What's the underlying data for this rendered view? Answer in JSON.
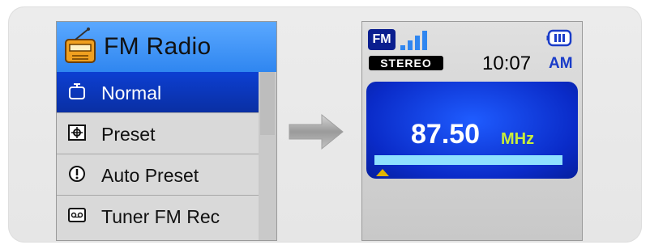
{
  "menu": {
    "title": "FM Radio",
    "items": [
      {
        "label": "Normal",
        "icon": "timer-icon",
        "selected": true
      },
      {
        "label": "Preset",
        "icon": "preset-icon",
        "selected": false
      },
      {
        "label": "Auto Preset",
        "icon": "auto-preset-icon",
        "selected": false
      },
      {
        "label": "Tuner FM Rec",
        "icon": "record-icon",
        "selected": false
      }
    ]
  },
  "screen": {
    "band": "FM",
    "stereo": "STEREO",
    "time": "10:07",
    "ampm": "AM",
    "frequency": "87.50",
    "unit": "MHz",
    "signal_bars": 4
  },
  "colors": {
    "header_blue": "#3a8ff5",
    "selected_blue": "#0c3fd2",
    "tuner_blue": "#0a2bc8",
    "unit_green": "#c8ee3a",
    "bar_cyan": "#8ee0ff"
  }
}
